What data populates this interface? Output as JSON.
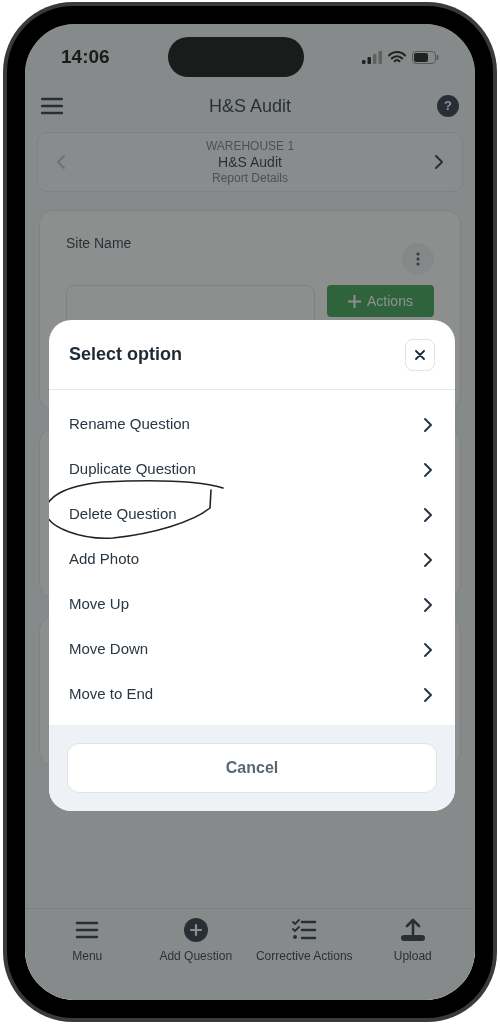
{
  "status_bar": {
    "time": "14:06"
  },
  "header": {
    "title": "H&S Audit",
    "help": "?"
  },
  "report_nav": {
    "eyebrow": "WAREHOUSE 1",
    "title": "H&S Audit",
    "subtitle": "Report Details"
  },
  "question_card": {
    "label": "Site Name",
    "action_button": "Actions"
  },
  "dialog": {
    "title": "Select option",
    "options": [
      {
        "label": "Rename Question",
        "circled": false
      },
      {
        "label": "Duplicate Question",
        "circled": false
      },
      {
        "label": "Delete Question",
        "circled": true
      },
      {
        "label": "Add Photo",
        "circled": false
      },
      {
        "label": "Move Up",
        "circled": false
      },
      {
        "label": "Move Down",
        "circled": false
      },
      {
        "label": "Move to End",
        "circled": false
      }
    ],
    "cancel": "Cancel"
  },
  "bottom_nav": [
    {
      "label": "Menu",
      "kind": "menu"
    },
    {
      "label": "Add Question",
      "kind": "add"
    },
    {
      "label": "Corrective Actions",
      "kind": "checklist"
    },
    {
      "label": "Upload",
      "kind": "upload"
    }
  ]
}
